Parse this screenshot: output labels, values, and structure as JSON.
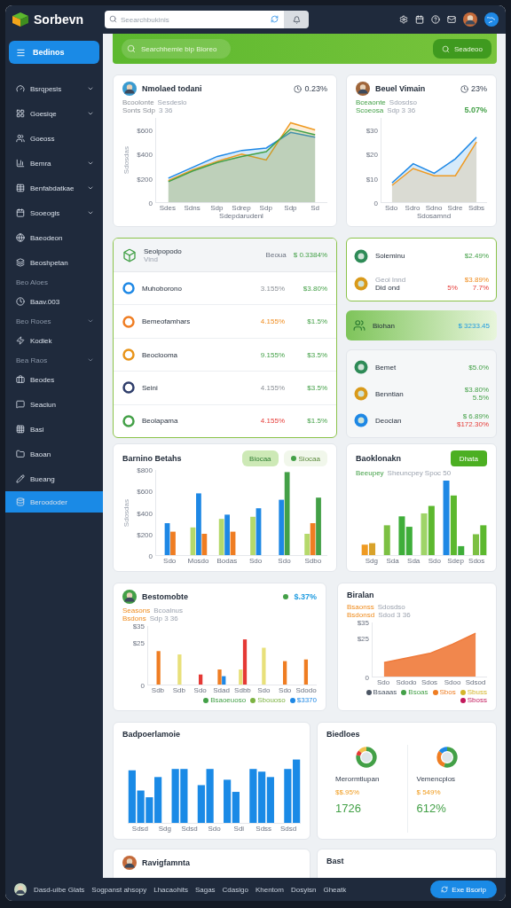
{
  "header": {
    "brand": "Sorbevn",
    "search": {
      "placeholder": "Seearchbukinis"
    }
  },
  "sidebar": {
    "items": [
      {
        "kind": "button",
        "label": "Bedinos"
      },
      {
        "kind": "item",
        "label": "Bsrqpesis",
        "chevron": true,
        "selected": false
      },
      {
        "kind": "item",
        "label": "Goesiqe",
        "chevron": true,
        "selected": false
      },
      {
        "kind": "item",
        "label": "Goeoss",
        "chevron": false,
        "selected": false
      },
      {
        "kind": "item",
        "label": "Bemra",
        "chevron": true,
        "selected": false
      },
      {
        "kind": "item",
        "label": "Benfabdatkae",
        "chevron": true,
        "selected": false
      },
      {
        "kind": "item",
        "label": "Sooeogis",
        "chevron": true,
        "selected": false
      },
      {
        "kind": "item",
        "label": "Baeodeon",
        "chevron": false,
        "selected": false
      },
      {
        "kind": "item",
        "label": "Beoshpetan",
        "chevron": false,
        "selected": false
      },
      {
        "kind": "section",
        "label": "Beo Aloes",
        "chevron": false
      },
      {
        "kind": "item",
        "label": "Baav.003",
        "chevron": false,
        "selected": false
      },
      {
        "kind": "section",
        "label": "Beo Rooes",
        "chevron": true
      },
      {
        "kind": "item",
        "label": "Kodiek",
        "chevron": false,
        "selected": false
      },
      {
        "kind": "section",
        "label": "Bea Raos",
        "chevron": true
      },
      {
        "kind": "item",
        "label": "Beodes",
        "chevron": false,
        "selected": false
      },
      {
        "kind": "item",
        "label": "Seaciun",
        "chevron": false,
        "selected": false
      },
      {
        "kind": "item",
        "label": "Basi",
        "chevron": false,
        "selected": false
      },
      {
        "kind": "item",
        "label": "Baoan",
        "chevron": false,
        "selected": false
      },
      {
        "kind": "item",
        "label": "Bueang",
        "chevron": false,
        "selected": false
      },
      {
        "kind": "item",
        "label": "Beroododer",
        "chevron": false,
        "selected": true
      }
    ]
  },
  "banner": {
    "pill": "Searchhemie bip Bioreo",
    "button": "Seadeoo"
  },
  "rows": [
    {
      "cards": [
        {
          "kind": "line_chart",
          "title": "Nmolaed todani",
          "badge": "0.23%",
          "legend": [
            {
              "key": "Bcoolonte",
              "text": "Sesdeslo",
              "kind": "neutral"
            },
            {
              "key": "Sonts Sdp",
              "text": "3 36",
              "kind": "neutral"
            }
          ],
          "chart_data": {
            "type": "area",
            "ylabel": "Sdosdas",
            "xlabel": "Sdepdarudenl",
            "categories": [
              "Sdes",
              "Sdns",
              "Sdp",
              "Sdrep",
              "Sdp",
              "Sdp",
              "Sd"
            ],
            "ylim": [
              0,
              700
            ],
            "yticks": [
              {
                "value": 0,
                "label": "0"
              },
              {
                "value": 200,
                "label": "$200"
              },
              {
                "value": 400,
                "label": "$400"
              },
              {
                "value": 600,
                "label": "$600"
              }
            ],
            "series": [
              {
                "color": "#1e88e5",
                "values": [
                  200,
                  290,
                  380,
                  430,
                  450,
                  580,
                  540
                ]
              },
              {
                "color": "#ef9a22",
                "values": [
                  180,
                  270,
                  340,
                  400,
                  350,
                  660,
                  600
                ]
              },
              {
                "color": "#43a047",
                "values": [
                  170,
                  260,
                  330,
                  380,
                  420,
                  610,
                  560
                ]
              }
            ]
          }
        },
        {
          "kind": "line_chart",
          "title": "Beuel Vimain",
          "badge": "23%",
          "highlight": "5.07%",
          "legend": [
            {
              "key": "Bceaonte",
              "text": "Sdosdso",
              "kind": "positive"
            },
            {
              "key": "Scoeosa",
              "text": "Sdp 3 36",
              "kind": "positive"
            }
          ],
          "chart_data": {
            "type": "area",
            "xlabel": "Sdosamnd",
            "categories": [
              "Sdo",
              "Sdro",
              "Sdno",
              "Sdre",
              "Sdbs"
            ],
            "ylim": [
              0,
              35
            ],
            "yticks": [
              {
                "value": 0,
                "label": "0"
              },
              {
                "value": 10,
                "label": "$10"
              },
              {
                "value": 20,
                "label": "$20"
              },
              {
                "value": 30,
                "label": "$30"
              }
            ],
            "series": [
              {
                "color": "#1e88e5",
                "values": [
                  8,
                  16,
                  12,
                  18,
                  27
                ]
              },
              {
                "color": "#ef9a22",
                "values": [
                  7,
                  14,
                  11,
                  11,
                  25
                ]
              }
            ]
          }
        }
      ]
    },
    {
      "cards": [
        {
          "kind": "list",
          "title": "Seolpopodo",
          "subtitle": "Vind",
          "col_1": "Beoua",
          "col_2": "$ 0.3384%",
          "rows": [
            {
              "name": "Muhoborono",
              "change": "3.155%",
              "kind": "neutral",
              "value": "$3.80%"
            },
            {
              "name": "Bemeofamhars",
              "change": "4.155%",
              "kind": "warning",
              "value": "$1.5%"
            },
            {
              "name": "Beoclooma",
              "change": "9.155%",
              "kind": "positive",
              "value": "$3.5%"
            },
            {
              "name": "Seini",
              "change": "4.155%",
              "kind": "neutral",
              "value": "$3.5%"
            },
            {
              "name": "Beolapama",
              "change": "4.155%",
              "kind": "negative",
              "value": "$1.5%"
            }
          ]
        },
        {
          "kind": "stats",
          "top": [
            {
              "name": "Soleminu",
              "values": [
                {
                  "text": "$2.49%",
                  "kind": "positive"
                }
              ]
            },
            {
              "note": "Geoi lnnd",
              "name": "Did ond",
              "change": {
                "text": "5%",
                "kind": "negative"
              },
              "values": [
                {
                  "text": "$3.89%",
                  "kind": "warning"
                },
                {
                  "text": "7.7%",
                  "kind": "negative"
                }
              ]
            }
          ],
          "highlight": {
            "name": "Biohan",
            "value": "$ 3233.45"
          },
          "rows": [
            {
              "name": "Bemet",
              "values": [
                {
                  "text": "$5.0%",
                  "kind": "positive"
                }
              ]
            },
            {
              "name": "Benntian",
              "values": [
                {
                  "text": "$3.80%",
                  "kind": "positive"
                },
                {
                  "text": "5.5%",
                  "kind": "positive"
                }
              ]
            },
            {
              "name": "Deocian",
              "values": [
                {
                  "text": "$ 6.89%",
                  "kind": "positive"
                },
                {
                  "text": "$172.30%",
                  "kind": "negative"
                }
              ]
            }
          ]
        }
      ]
    },
    {
      "cards": [
        {
          "kind": "bar_chart",
          "title": "Barnino Betahs",
          "toggles": [
            {
              "label": "Biocaa",
              "selected": true
            },
            {
              "label": "Siocaa",
              "selected": false
            }
          ],
          "chart_data": {
            "type": "bar",
            "ylabel": "Sdosdas",
            "categories": [
              "Sdo",
              "Mosdo",
              "Bodas",
              "Sdo",
              "Sdo",
              "Sdbo"
            ],
            "ylim": [
              0,
              800
            ],
            "yticks": [
              {
                "value": 0,
                "label": "0"
              },
              {
                "value": 200,
                "label": "$200"
              },
              {
                "value": 400,
                "label": "$400"
              },
              {
                "value": 600,
                "label": "$600"
              },
              {
                "value": 800,
                "label": "$800"
              }
            ],
            "series": [
              {
                "color": "#b5d96b",
                "values": [
                  null,
                  260,
                  340,
                  360,
                  null,
                  200
                ]
              },
              {
                "color": "#1e88e5",
                "values": [
                  300,
                  580,
                  380,
                  440,
                  520,
                  null
                ]
              },
              {
                "color": "#ef7d22",
                "values": [
                  220,
                  200,
                  220,
                  null,
                  null,
                  300
                ]
              },
              {
                "color": "#43a047",
                "values": [
                  null,
                  null,
                  null,
                  null,
                  780,
                  540
                ]
              }
            ]
          }
        },
        {
          "kind": "bar_picture",
          "title": "Baoklonakn",
          "button": "Dhata",
          "legend": [
            {
              "key": "Beeupey",
              "text": "Sheuncpey Spoc 50",
              "kind": "positive"
            }
          ],
          "x_ticks": [
            "Sdg",
            "Sda",
            "Sda",
            "Sdo",
            "Sdep",
            "Sdos"
          ]
        }
      ]
    },
    {
      "cards": [
        {
          "kind": "bar_chart",
          "title": "Bestomobte",
          "avatar": true,
          "highlight": "$.37%",
          "legend": [
            {
              "key": "Seasons",
              "text": "Bcoalnus",
              "kind": "warning"
            },
            {
              "key": "Bsdons",
              "text": "Sdp 3 36",
              "kind": "warning"
            }
          ],
          "chart_data": {
            "type": "bar",
            "categories": [
              "Sdb",
              "Sdb",
              "Sdo",
              "Sdad",
              "Sdbb",
              "Sdo",
              "Sdo",
              "Sdodo"
            ],
            "ylim": [
              0,
              35
            ],
            "yticks": [
              {
                "value": 0,
                "label": "0"
              },
              {
                "value": 25,
                "label": "$25"
              },
              {
                "value": 35,
                "label": "$35"
              }
            ],
            "series": [
              {
                "color": "#ef7d22",
                "values": [
                  20,
                  null,
                  null,
                  9,
                  null,
                  null,
                  14,
                  15
                ]
              },
              {
                "color": "#e8e07a",
                "values": [
                  null,
                  18,
                  null,
                  null,
                  9,
                  22,
                  null,
                  null
                ]
              },
              {
                "color": "#e53935",
                "values": [
                  null,
                  null,
                  6,
                  null,
                  27,
                  null,
                  null,
                  null
                ]
              },
              {
                "color": "#1e88e5",
                "values": [
                  null,
                  null,
                  null,
                  5,
                  null,
                  null,
                  null,
                  null
                ]
              }
            ]
          },
          "bottom_legend": [
            {
              "text": "Bsaoeuoso",
              "color": "#43a047"
            },
            {
              "text": "Sbouoso",
              "color": "#7cb342"
            },
            {
              "text": "$3370",
              "color": "#1e88e5"
            }
          ]
        },
        {
          "kind": "area_chart",
          "title": "Biralan",
          "legend": [
            {
              "key": "Bsaonss",
              "text": "Sdosdso",
              "kind": "warning"
            },
            {
              "key": "Bsdonsd",
              "text": "Sdod 3 36",
              "kind": "warning"
            }
          ],
          "chart_data": {
            "type": "area",
            "categories": [
              "Sdo",
              "Sdodo",
              "Sdos",
              "Sdoo",
              "Sdsod"
            ],
            "ylim": [
              0,
              35
            ],
            "yticks": [
              {
                "value": 0,
                "label": "0"
              },
              {
                "value": 25,
                "label": "$25"
              },
              {
                "value": 35,
                "label": "$35"
              }
            ],
            "series": [
              {
                "color": "#ef7a3a",
                "values": [
                  9,
                  12,
                  15,
                  21,
                  28
                ]
              }
            ]
          },
          "bottom_legend": [
            {
              "text": "Bsaaas",
              "color": "#4b5563"
            },
            {
              "text": "Bsoas",
              "color": "#43a047"
            },
            {
              "text": "Sbos",
              "color": "#ef7d22"
            },
            {
              "text": "Sbuss",
              "color": "#d4b52a"
            },
            {
              "text": "Sboss",
              "color": "#c2185b"
            }
          ]
        }
      ]
    },
    {
      "cards": [
        {
          "kind": "blue_bars",
          "title": "Badpoerlamoie",
          "x_ticks": [
            "Sdsd",
            "Sdg",
            "Sdsd",
            "Sdo",
            "Sdi",
            "Sdss",
            "Sdsd"
          ]
        },
        {
          "kind": "donuts",
          "title": "Biedloes",
          "items": [
            {
              "name": "Merormtlupan",
              "sub": "$$.95%",
              "value": "1726"
            },
            {
              "name": "Vemencplos",
              "sub": "$ 549%",
              "value": "612%"
            }
          ]
        }
      ]
    },
    {
      "cards": [
        {
          "kind": "stub",
          "title": "Ravigfamnta",
          "avatar": true
        },
        {
          "kind": "stub",
          "title": "Bast",
          "avatar": false
        }
      ]
    }
  ],
  "footer": {
    "links": [
      "Dasd-uibe Glats",
      "Sogpanst ahsopy",
      "Lhacaohits",
      "Sagas",
      "Cdasigo",
      "Khentom",
      "Dosyisn",
      "Gheatk"
    ],
    "button": "Exe Bsorip"
  }
}
